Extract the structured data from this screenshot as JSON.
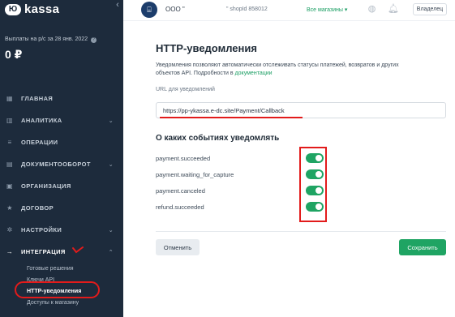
{
  "app": {
    "logo_text": "kassa",
    "logo_mark": "Ю"
  },
  "sidebar": {
    "collapse_icon": "chevron-left-icon",
    "payout_label": "Выплаты на р/с за 28 янв. 2022",
    "payout_help": "?",
    "payout_amount": "0 ₽",
    "items": [
      {
        "label": "ГЛАВНАЯ",
        "icon": "grid-icon",
        "glyph": "▦"
      },
      {
        "label": "АНАЛИТИКА",
        "icon": "chart-icon",
        "glyph": "▥",
        "chevron": "⌄"
      },
      {
        "label": "ОПЕРАЦИИ",
        "icon": "list-icon",
        "glyph": "≡"
      },
      {
        "label": "ДОКУМЕНТООБОРОТ",
        "icon": "document-icon",
        "glyph": "▤",
        "chevron": "⌄"
      },
      {
        "label": "ОРГАНИЗАЦИЯ",
        "icon": "building-icon",
        "glyph": "▣"
      },
      {
        "label": "ДОГОВОР",
        "icon": "star-icon",
        "glyph": "★"
      },
      {
        "label": "НАСТРОЙКИ",
        "icon": "gear-icon",
        "glyph": "✲",
        "chevron": "⌄"
      },
      {
        "label": "ИНТЕГРАЦИЯ",
        "icon": "arrow-right-icon",
        "glyph": "→",
        "chevron": "⌃"
      }
    ],
    "sub_items": [
      {
        "label": "Готовые решения"
      },
      {
        "label": "Ключи API"
      },
      {
        "label": "HTTP-уведомления"
      },
      {
        "label": "Доступы к магазину"
      }
    ]
  },
  "topbar": {
    "avatar_glyph": "⌸",
    "org_name": "ООО \"",
    "shop_id": "\"  shopId 858012",
    "all_shops": "Все магазины ▾",
    "support_icon": "support-icon",
    "bell_icon": "bell-icon",
    "owner_button": "Владелец"
  },
  "main": {
    "title": "HTTP-уведомления",
    "description": "Уведомления позволяют автоматически отслеживать статусы платежей, возвратов и других объектов API. Подробности в",
    "description_link": "документации",
    "url_label": "URL для уведомлений",
    "url_value": "https://pp-ykassa.e-dc.site/Payment/Callback",
    "events_title": "О каких событиях уведомлять",
    "events": [
      {
        "label": "payment.succeeded",
        "enabled": true
      },
      {
        "label": "payment.waiting_for_capture",
        "enabled": true
      },
      {
        "label": "payment.canceled",
        "enabled": true
      },
      {
        "label": "refund.succeeded",
        "enabled": true
      }
    ],
    "cancel_label": "Отменить",
    "save_label": "Сохранить"
  },
  "colors": {
    "sidebar_bg": "#1d2b3c",
    "accent_green": "#1fa463",
    "annotation_red": "#e21b1b"
  }
}
